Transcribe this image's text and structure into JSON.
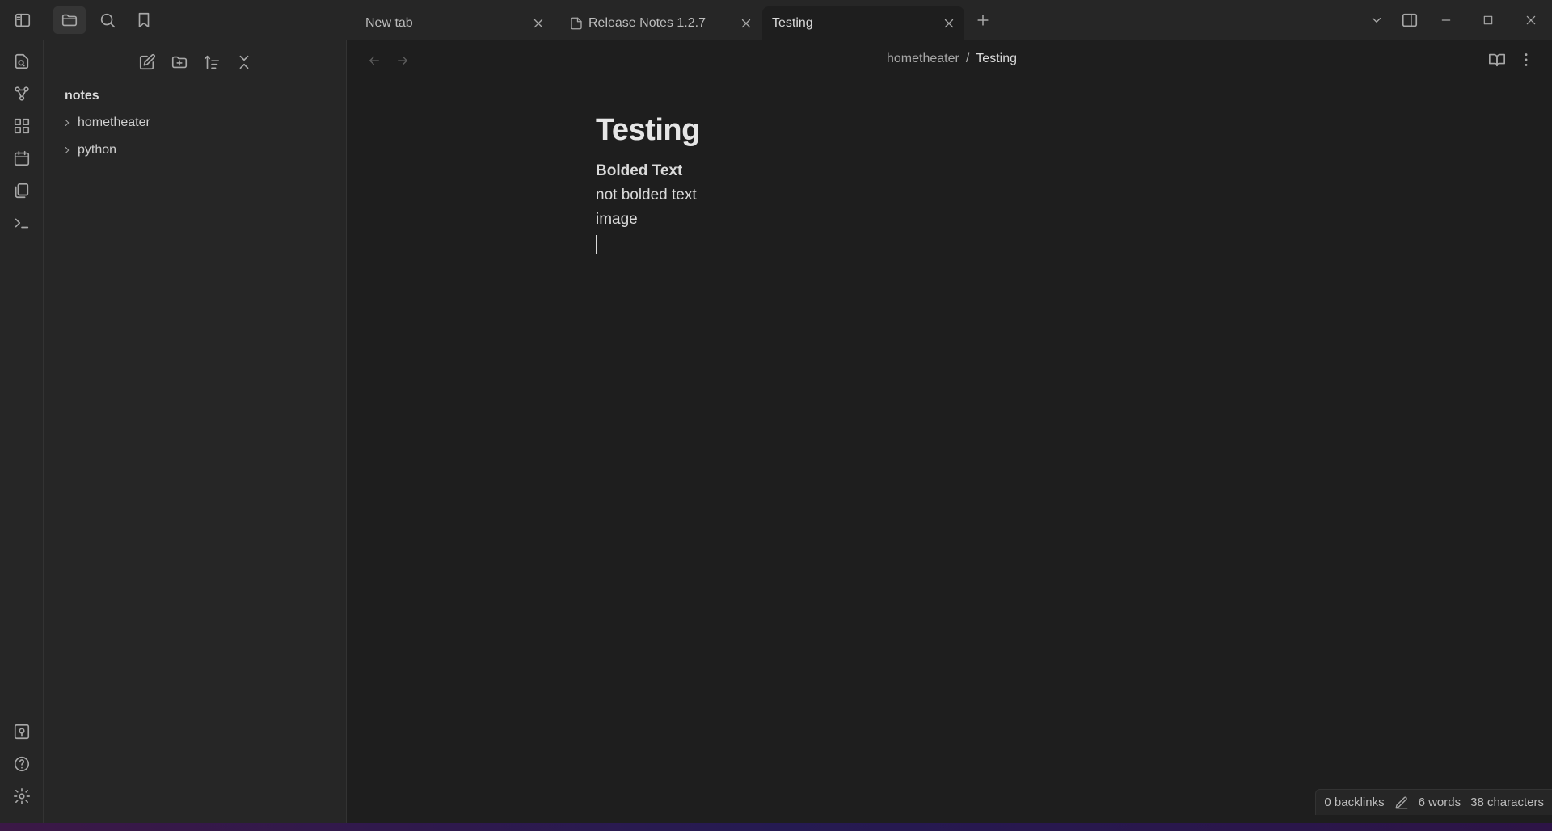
{
  "tabs": [
    {
      "label": "New tab",
      "active": false
    },
    {
      "label": "Release Notes 1.2.7",
      "active": false
    },
    {
      "label": "Testing",
      "active": true
    }
  ],
  "explorer": {
    "vault_name": "notes",
    "folders": [
      {
        "label": "hometheater"
      },
      {
        "label": "python"
      }
    ]
  },
  "breadcrumb": {
    "parent": "hometheater",
    "separator": "/",
    "current": "Testing"
  },
  "note": {
    "title": "Testing",
    "lines": [
      "Bolded Text",
      "not bolded text",
      "image"
    ]
  },
  "status": {
    "backlinks": "0 backlinks",
    "words": "6 words",
    "characters": "38 characters"
  },
  "colors": {
    "background": "#1e1e1e",
    "panel": "#262626",
    "text": "#dadada",
    "muted": "#a8a8a8"
  },
  "icons": {
    "ribbon_top": [
      "open-quick-switcher-icon",
      "graph-view-icon",
      "canvas-icon",
      "daily-note-icon",
      "templates-icon",
      "command-palette-icon"
    ],
    "ribbon_bottom": [
      "open-vault-icon",
      "help-icon",
      "settings-icon"
    ]
  }
}
